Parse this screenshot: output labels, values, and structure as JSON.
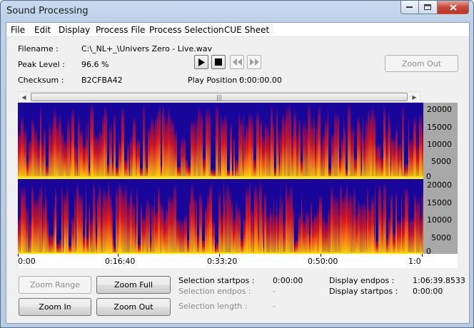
{
  "window": {
    "title": "Sound Processing"
  },
  "menu": [
    "File",
    "Edit",
    "Display",
    "Process File",
    "Process Selection",
    "CUE Sheet"
  ],
  "info": {
    "filename_label": "Filename :",
    "filename_value": "C:\\_NL+_\\Univers Zero - Live.wav",
    "peak_label": "Peak Level :",
    "peak_value": "96.6 %",
    "checksum_label": "Checksum :",
    "checksum_value": "B2CFBA42",
    "play_position_label": "Play Position :",
    "play_position_value": "0:00:00.00"
  },
  "transport": {
    "play_icon": "play-icon",
    "stop_icon": "stop-icon",
    "rewind_icon": "rewind-icon",
    "forward_icon": "fast-forward-icon"
  },
  "zoom_out_top_label": "Zoom Out",
  "spectrogram": {
    "freq_labels_top": [
      "20000",
      "15000",
      "10000",
      "5000",
      "0"
    ],
    "freq_labels_bottom": [
      "20000",
      "15000",
      "10000",
      "5000",
      "0"
    ],
    "time_labels": [
      "0:00",
      "0:16:40",
      "0:33:20",
      "0:50:00",
      "1:0"
    ],
    "colors": {
      "low": "#18069a",
      "mid": "#e01818",
      "high": "#ffe000"
    }
  },
  "buttons": {
    "zoom_range": "Zoom Range",
    "zoom_full": "Zoom Full",
    "zoom_in": "Zoom In",
    "zoom_out": "Zoom Out"
  },
  "selection": {
    "startpos_label": "Selection startpos :",
    "startpos_value": "0:00:00",
    "endpos_label": "Selection endpos :",
    "endpos_value": "-",
    "length_label": "Selection length :",
    "length_value": "-"
  },
  "display": {
    "endpos_label": "Display endpos :",
    "endpos_value": "1:06:39.8533",
    "startpos_label": "Display startpos :",
    "startpos_value": "0:00:00"
  }
}
